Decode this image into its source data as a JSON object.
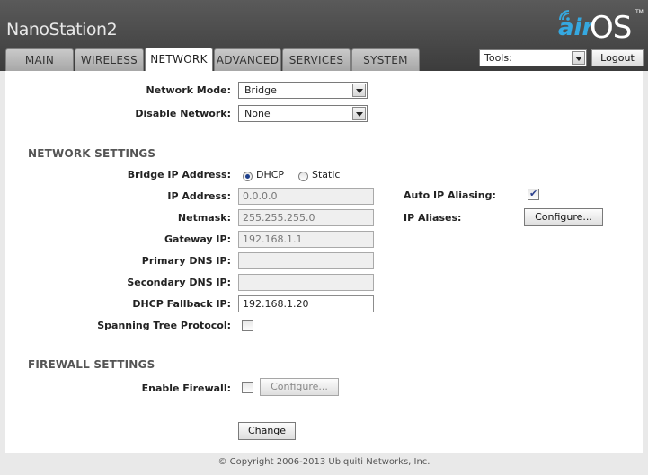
{
  "header": {
    "device_name": "NanoStation2",
    "logo_air": "air",
    "logo_os": "OS",
    "logo_tm": "TM"
  },
  "tabs": [
    {
      "label": "MAIN"
    },
    {
      "label": "WIRELESS"
    },
    {
      "label": "NETWORK",
      "active": true
    },
    {
      "label": "ADVANCED"
    },
    {
      "label": "SERVICES"
    },
    {
      "label": "SYSTEM"
    }
  ],
  "toolbar": {
    "tools_value": "Tools:",
    "logout_label": "Logout"
  },
  "network_mode": {
    "label": "Network Mode:",
    "value": "Bridge"
  },
  "disable_network": {
    "label": "Disable Network:",
    "value": "None"
  },
  "network_settings": {
    "title": "NETWORK SETTINGS",
    "bridge_ip": {
      "label": "Bridge IP Address:",
      "dhcp_label": "DHCP",
      "static_label": "Static",
      "selected": "DHCP"
    },
    "ip_address": {
      "label": "IP Address:",
      "value": "0.0.0.0"
    },
    "netmask": {
      "label": "Netmask:",
      "value": "255.255.255.0"
    },
    "gateway_ip": {
      "label": "Gateway IP:",
      "value": "192.168.1.1"
    },
    "primary_dns": {
      "label": "Primary DNS IP:",
      "value": ""
    },
    "secondary_dns": {
      "label": "Secondary DNS IP:",
      "value": ""
    },
    "dhcp_fallback": {
      "label": "DHCP Fallback IP:",
      "value": "192.168.1.20"
    },
    "stp": {
      "label": "Spanning Tree Protocol:",
      "checked": false
    },
    "auto_ip_aliasing": {
      "label": "Auto IP Aliasing:",
      "checked": true
    },
    "ip_aliases": {
      "label": "IP Aliases:",
      "button_label": "Configure..."
    }
  },
  "firewall_settings": {
    "title": "FIREWALL SETTINGS",
    "enable_firewall": {
      "label": "Enable Firewall:",
      "checked": false
    },
    "configure_label": "Configure..."
  },
  "change_label": "Change",
  "footer": {
    "copyright": "© Copyright 2006-2013 Ubiquiti Networks, Inc."
  }
}
